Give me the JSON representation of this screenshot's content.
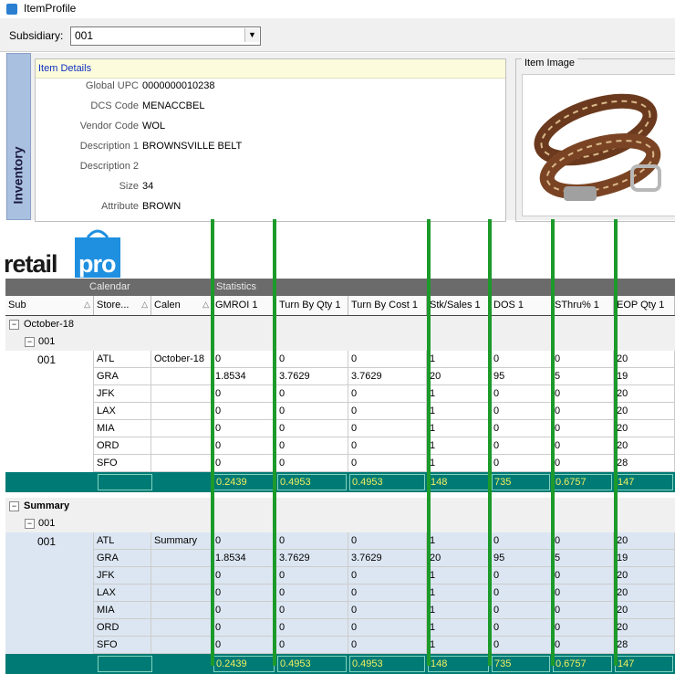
{
  "window": {
    "title": "ItemProfile"
  },
  "subsidiary": {
    "label": "Subsidiary:",
    "value": "001"
  },
  "inventory_tab": {
    "label": "Inventory"
  },
  "details": {
    "header": "Item Details",
    "fields": [
      {
        "label": "Global UPC",
        "value": "0000000010238"
      },
      {
        "label": "DCS Code",
        "value": "MENACCBEL"
      },
      {
        "label": "Vendor Code",
        "value": "WOL"
      },
      {
        "label": "Description 1",
        "value": "BROWNSVILLE BELT"
      },
      {
        "label": "Description 2",
        "value": ""
      },
      {
        "label": "Size",
        "value": "34"
      },
      {
        "label": "Attribute",
        "value": "BROWN"
      }
    ]
  },
  "item_image": {
    "caption": "Item Image"
  },
  "logo": {
    "text_a": "retail",
    "text_b": "pro"
  },
  "grid": {
    "group_headers": {
      "calendar": "Calendar",
      "statistics": "Statistics"
    },
    "columns": [
      "Sub",
      "Store...",
      "Calen",
      "GMROI 1",
      "Turn By Qty 1",
      "Turn By Cost 1",
      "Stk/Sales 1",
      "DOS 1",
      "SThru% 1",
      "EOP Qty 1"
    ],
    "groups": [
      {
        "label": "October-18",
        "sub_label": "001",
        "sub": "001",
        "calendar": "October-18",
        "rows": [
          {
            "store": "ATL",
            "vals": [
              "0",
              "0",
              "0",
              "1",
              "0",
              "0",
              "20"
            ]
          },
          {
            "store": "GRA",
            "vals": [
              "1.8534",
              "3.7629",
              "3.7629",
              "20",
              "95",
              "5",
              "19"
            ]
          },
          {
            "store": "JFK",
            "vals": [
              "0",
              "0",
              "0",
              "1",
              "0",
              "0",
              "20"
            ]
          },
          {
            "store": "LAX",
            "vals": [
              "0",
              "0",
              "0",
              "1",
              "0",
              "0",
              "20"
            ]
          },
          {
            "store": "MIA",
            "vals": [
              "0",
              "0",
              "0",
              "1",
              "0",
              "0",
              "20"
            ]
          },
          {
            "store": "ORD",
            "vals": [
              "0",
              "0",
              "0",
              "1",
              "0",
              "0",
              "20"
            ]
          },
          {
            "store": "SFO",
            "vals": [
              "0",
              "0",
              "0",
              "1",
              "0",
              "0",
              "28"
            ]
          }
        ],
        "totals": [
          "0.2439",
          "0.4953",
          "0.4953",
          "148",
          "735",
          "0.6757",
          "147"
        ]
      },
      {
        "label": "Summary",
        "sub_label": "001",
        "sub": "001",
        "calendar": "Summary",
        "rows": [
          {
            "store": "ATL",
            "vals": [
              "0",
              "0",
              "0",
              "1",
              "0",
              "0",
              "20"
            ]
          },
          {
            "store": "GRA",
            "vals": [
              "1.8534",
              "3.7629",
              "3.7629",
              "20",
              "95",
              "5",
              "19"
            ]
          },
          {
            "store": "JFK",
            "vals": [
              "0",
              "0",
              "0",
              "1",
              "0",
              "0",
              "20"
            ]
          },
          {
            "store": "LAX",
            "vals": [
              "0",
              "0",
              "0",
              "1",
              "0",
              "0",
              "20"
            ]
          },
          {
            "store": "MIA",
            "vals": [
              "0",
              "0",
              "0",
              "1",
              "0",
              "0",
              "20"
            ]
          },
          {
            "store": "ORD",
            "vals": [
              "0",
              "0",
              "0",
              "1",
              "0",
              "0",
              "20"
            ]
          },
          {
            "store": "SFO",
            "vals": [
              "0",
              "0",
              "0",
              "1",
              "0",
              "0",
              "28"
            ]
          }
        ],
        "totals": [
          "0.2439",
          "0.4953",
          "0.4953",
          "148",
          "735",
          "0.6757",
          "147"
        ]
      }
    ]
  },
  "colors": {
    "total_bg": "#007a74",
    "total_text": "#f0f060",
    "marker_lines": "#1c9a2a",
    "summary_row_bg": "#dce6f2"
  }
}
